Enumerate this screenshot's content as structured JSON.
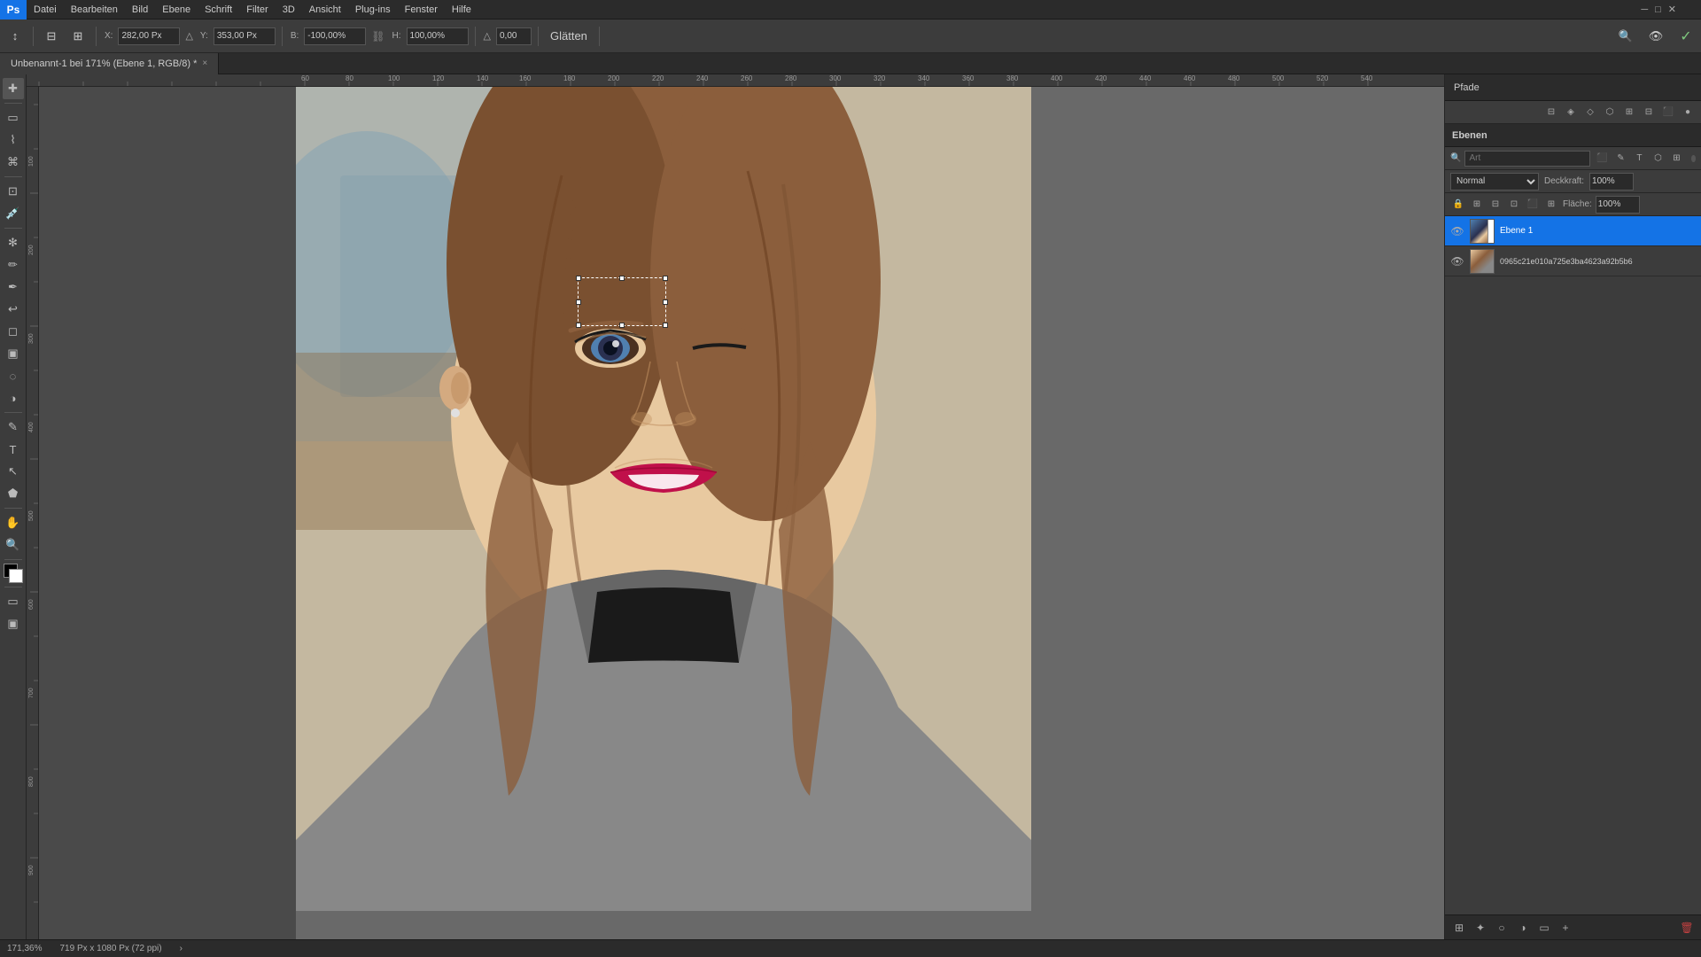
{
  "app": {
    "name": "Adobe Photoshop",
    "logo": "Ps"
  },
  "menubar": {
    "items": [
      "Datei",
      "Bearbeiten",
      "Bild",
      "Ebene",
      "Schrift",
      "Filter",
      "3D",
      "Ansicht",
      "Plug-ins",
      "Fenster",
      "Hilfe"
    ]
  },
  "toolbar": {
    "x_label": "X:",
    "x_value": "282,00 Px",
    "y_label": "Y:",
    "y_value": "353,00 Px",
    "width_label": "B:",
    "width_value": "-100,00%",
    "height_label": "H:",
    "height_value": "100,00%",
    "rotation_label": "△",
    "rotation_value": "0,00",
    "warp_label": "Glätten",
    "confirm": "✓",
    "cancel": "✗"
  },
  "tabbar": {
    "tab_label": "Unbenannt-1 bei 171% (Ebene 1, RGB/8) *",
    "close": "×"
  },
  "pfade": {
    "label": "Pfade"
  },
  "ebenen": {
    "label": "Ebenen",
    "search_placeholder": "Art",
    "blend_mode": "Normal",
    "opacity_label": "Deckkraft:",
    "opacity_value": "100%",
    "fill_label": "Fläche:",
    "fill_value": "100%",
    "layers": [
      {
        "id": 1,
        "name": "Ebene 1",
        "visible": true,
        "selected": true
      },
      {
        "id": 2,
        "name": "0965c21e010a725e3ba4623a92b5b6",
        "visible": true,
        "selected": false
      }
    ]
  },
  "statusbar": {
    "zoom": "171,36%",
    "size": "719 Px x 1080 Px (72 ppi)"
  },
  "tools": {
    "items": [
      "↕",
      "⊹",
      "○",
      "⟲",
      "✂",
      "✒",
      "⌦",
      "⊘",
      "⬛",
      "T",
      "↗",
      "⬡",
      "🖐",
      "🔍",
      "✏",
      "◐"
    ]
  }
}
